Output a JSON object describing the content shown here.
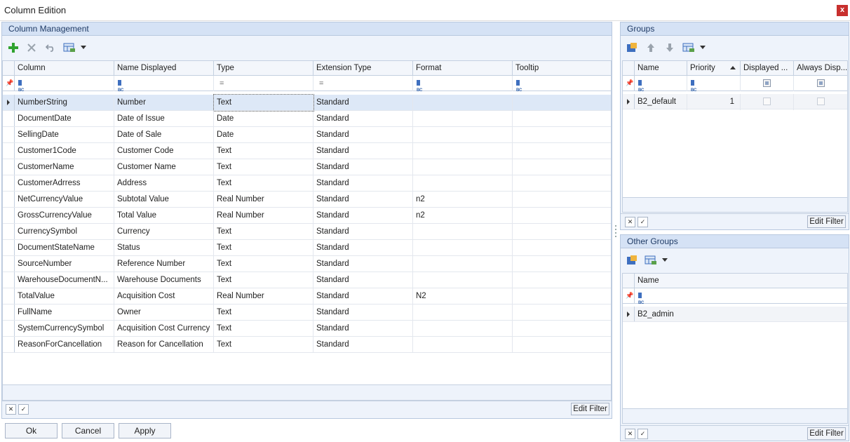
{
  "window": {
    "title": "Column Edition",
    "close_glyph": "x"
  },
  "column_management": {
    "title": "Column Management",
    "toolbar": [
      "add-icon",
      "delete-icon",
      "undo-icon",
      "grid-layout-icon",
      "dropdown-arrow-icon"
    ],
    "headers": [
      "Column",
      "Name Displayed",
      "Type",
      "Extension Type",
      "Format",
      "Tooltip"
    ],
    "rows": [
      [
        "NumberString",
        "Number",
        "Text",
        "Standard",
        "",
        ""
      ],
      [
        "DocumentDate",
        "Date of Issue",
        "Date",
        "Standard",
        "",
        ""
      ],
      [
        "SellingDate",
        "Date of Sale",
        "Date",
        "Standard",
        "",
        ""
      ],
      [
        "Customer1Code",
        "Customer Code",
        "Text",
        "Standard",
        "",
        ""
      ],
      [
        "CustomerName",
        "Customer Name",
        "Text",
        "Standard",
        "",
        ""
      ],
      [
        "CustomerAdrress",
        "Address",
        "Text",
        "Standard",
        "",
        ""
      ],
      [
        "NetCurrencyValue",
        "Subtotal Value",
        "Real Number",
        "Standard",
        "n2",
        ""
      ],
      [
        "GrossCurrencyValue",
        "Total Value",
        "Real Number",
        "Standard",
        "n2",
        ""
      ],
      [
        "CurrencySymbol",
        "Currency",
        "Text",
        "Standard",
        "",
        ""
      ],
      [
        "DocumentStateName",
        "Status",
        "Text",
        "Standard",
        "",
        ""
      ],
      [
        "SourceNumber",
        "Reference Number",
        "Text",
        "Standard",
        "",
        ""
      ],
      [
        "WarehouseDocumentN...",
        "Warehouse Documents",
        "Text",
        "Standard",
        "",
        ""
      ],
      [
        "TotalValue",
        "Acquisition Cost",
        "Real Number",
        "Standard",
        "N2",
        ""
      ],
      [
        "FullName",
        "Owner",
        "Text",
        "Standard",
        "",
        ""
      ],
      [
        "SystemCurrencySymbol",
        "Acquisition Cost Currency",
        "Text",
        "Standard",
        "",
        ""
      ],
      [
        "ReasonForCancellation",
        "Reason for Cancellation",
        "Text",
        "Standard",
        "",
        ""
      ]
    ],
    "edit_filter": "Edit Filter"
  },
  "groups": {
    "title": "Groups",
    "headers": [
      "Name",
      "Priority",
      "Displayed ...",
      "Always Disp..."
    ],
    "rows": [
      {
        "name": "B2_default",
        "priority": "1",
        "displayed": false,
        "always": false
      }
    ],
    "edit_filter": "Edit Filter"
  },
  "other_groups": {
    "title": "Other Groups",
    "headers": [
      "Name"
    ],
    "rows": [
      "B2_admin"
    ],
    "edit_filter": "Edit Filter"
  },
  "buttons": {
    "ok": "Ok",
    "cancel": "Cancel",
    "apply": "Apply"
  },
  "colors": {
    "panel_header": "#d5e2f5",
    "selection": "#dde8f7",
    "add_icon": "#2fa32f",
    "close": "#c8302e"
  }
}
